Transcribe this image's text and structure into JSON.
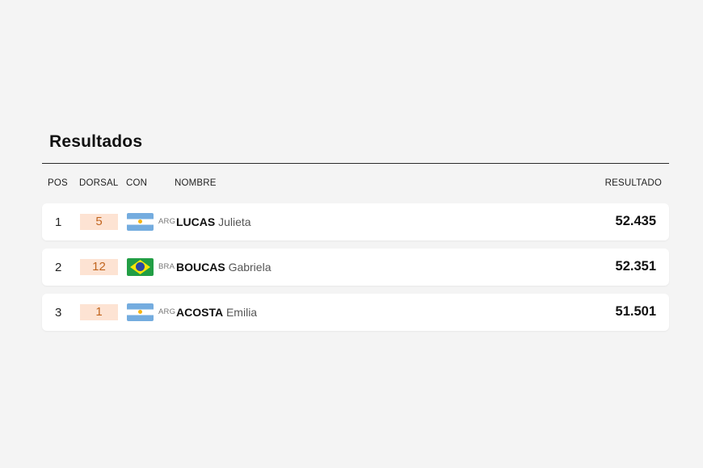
{
  "page": {
    "title": "Resultados"
  },
  "columns": {
    "pos": "POS",
    "dorsal": "DORSAL",
    "con": "CON",
    "nombre": "NOMBRE",
    "resultado": "RESULTADO"
  },
  "rows": [
    {
      "pos": "1",
      "dorsal": "5",
      "country": "ARG",
      "flag": "argentina-flag-icon",
      "last": "LUCAS",
      "first": "Julieta",
      "result": "52.435"
    },
    {
      "pos": "2",
      "dorsal": "12",
      "country": "BRA",
      "flag": "brazil-flag-icon",
      "last": "BOUCAS",
      "first": "Gabriela",
      "result": "52.351"
    },
    {
      "pos": "3",
      "dorsal": "1",
      "country": "ARG",
      "flag": "argentina-flag-icon",
      "last": "ACOSTA",
      "first": "Emilia",
      "result": "51.501"
    }
  ],
  "colors": {
    "bib_bg": "#fde3d3",
    "bib_text": "#c1651f",
    "background": "#f4f4f4"
  }
}
